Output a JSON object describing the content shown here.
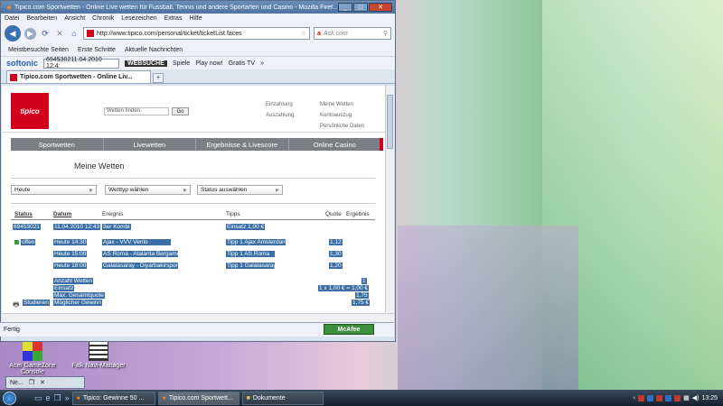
{
  "browser": {
    "title": "Tipico.com Sportwetten - Online Live wetten für Fussball, Tennis und andere Sportarten und Casino - Mozilla Firef...",
    "menu": [
      "Datei",
      "Bearbeiten",
      "Ansicht",
      "Chronik",
      "Lesezeichen",
      "Extras",
      "Hilfe"
    ],
    "url": "http://www.tipico.com/personal/ticket/ticketList.faces",
    "search_placeholder": "Ask.com",
    "bookmarks": [
      "Meistbesuchte Seiten",
      "Erste Schritte",
      "Aktuelle Nachrichten"
    ],
    "toolbar": {
      "brand": "softonic",
      "field": "694530211.04.2010 12:4:",
      "web": "WEBSUCHE",
      "spiele": "Spiele",
      "play": "Play now!",
      "gratis": "Gratis TV"
    },
    "tab_label": "Tipico.com Sportwetten - Online Liv...",
    "status": "Fertig",
    "mcafee": "McAfee"
  },
  "page": {
    "logo": "tipico",
    "search_placeholder": "Wetten finden",
    "go": "Go",
    "links_left": [
      "Einzahlung",
      "Auszahlung"
    ],
    "links_right": [
      "Meine Wetten",
      "Kontoauszug",
      "Persönliche Daten"
    ],
    "nav": [
      "Sportwetten",
      "Livewetten",
      "Ergebnisse & Livescore",
      "Online Casino"
    ],
    "title": "Meine Wetten",
    "filters": [
      "Heute",
      "Wetttyp wählen",
      "Status auswählen"
    ],
    "columns": {
      "status": "Status",
      "datum": "Datum",
      "ereignis": "Ereignis",
      "tipps": "Tipps",
      "quote": "Quote",
      "ergebnis": "Ergebnis"
    },
    "ticket": {
      "id": "69453021",
      "datum": "11.04.2010 12:43",
      "ereignis": "3er Kombi",
      "tipps": "Einsatz 1,00 €"
    },
    "status_offen": "offen",
    "rows": [
      {
        "datum": "Heute 14:30",
        "ereignis": "Ajax - VVV Venlo",
        "tipp": "Tipp 1 Ajax Amsterdam",
        "quote": "1,12"
      },
      {
        "datum": "Heute 15:00",
        "ereignis": "AS Roma - Atalanta Bergamo",
        "tipp": "Tipp 1 AS Roma",
        "quote": "1,30"
      },
      {
        "datum": "Heute 18:00",
        "ereignis": "Galatasaray - Diyarbakirspor",
        "tipp": "Tipp 1 Galatasaray",
        "quote": "1,20"
      }
    ],
    "summary": [
      {
        "label": "Anzahl Wetten",
        "value": "1"
      },
      {
        "label": "Einsatz",
        "value": "1 x 1,00 € = 1,00 €"
      },
      {
        "label": "Max. Gesamtquote",
        "value": "1,75"
      },
      {
        "label": "Möglicher Gewinn",
        "value": "1,75 €"
      }
    ],
    "studieren": "Studieren"
  },
  "desktop": {
    "icons": [
      {
        "label": "Acer GameZone Console"
      },
      {
        "label": "Falk Navi-Manager"
      }
    ],
    "popup": "Ne..."
  },
  "taskbar": {
    "items": [
      "Tipico: Gewinne 50 ...",
      "Tipico.com Sportwett...",
      "Dokumente"
    ],
    "clock": "13:25"
  }
}
